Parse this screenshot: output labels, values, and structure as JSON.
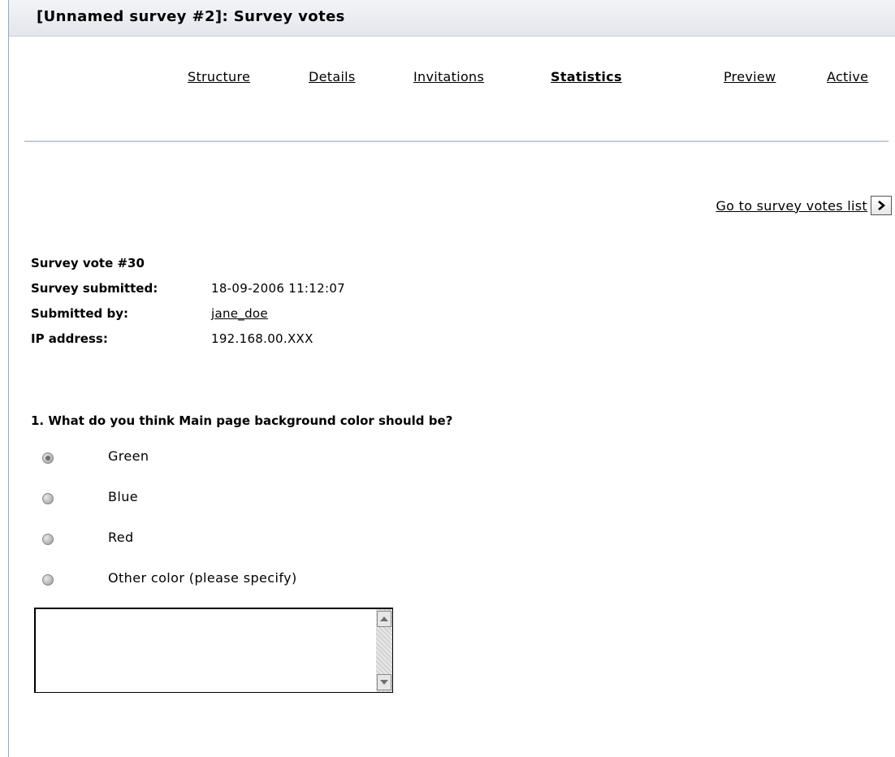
{
  "header": {
    "title": "[Unnamed survey #2]: Survey votes"
  },
  "tabs": [
    {
      "label": "Structure",
      "active": false
    },
    {
      "label": "Details",
      "active": false
    },
    {
      "label": "Invitations",
      "active": false
    },
    {
      "label": "Statistics",
      "active": true
    },
    {
      "label": "Preview",
      "active": false
    },
    {
      "label": "Active",
      "active": false
    }
  ],
  "goto": {
    "label": "Go to survey votes list"
  },
  "vote": {
    "title": "Survey vote #30",
    "submitted_label": "Survey submitted:",
    "submitted_value": "18-09-2006 11:12:07",
    "by_label": "Submitted by:",
    "by_value": "jane_doe",
    "ip_label": "IP address:",
    "ip_value": "192.168.00.XXX"
  },
  "question": {
    "text": "1. What do you think Main page background color should be?",
    "options": [
      {
        "label": "Green",
        "selected": true
      },
      {
        "label": "Blue",
        "selected": false
      },
      {
        "label": "Red",
        "selected": false
      },
      {
        "label": "Other color (please specify)",
        "selected": false
      }
    ],
    "other_text": ""
  },
  "colors": {
    "title_bar": "#e6e8ee",
    "divider": "#c4ccd6"
  },
  "icons": {
    "goto": "chevron-right-icon",
    "scroll_up": "scroll-up-arrow-icon",
    "scroll_down": "scroll-down-arrow-icon"
  }
}
